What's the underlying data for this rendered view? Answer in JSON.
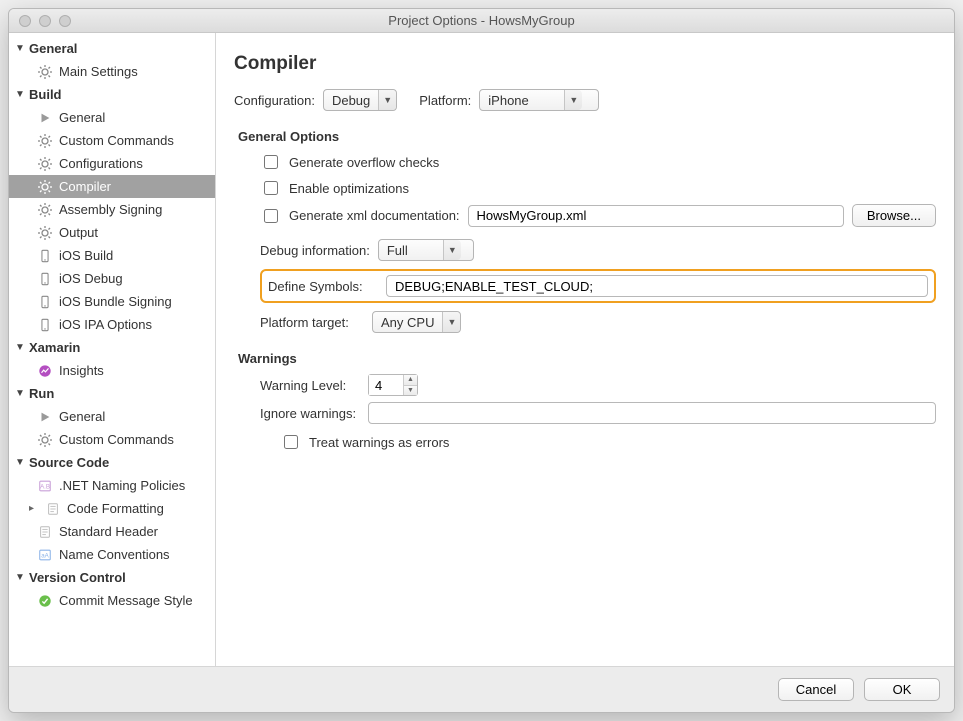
{
  "window": {
    "title": "Project Options - HowsMyGroup"
  },
  "sidebar": {
    "general": {
      "label": "General",
      "items": [
        {
          "label": "Main Settings"
        }
      ]
    },
    "build": {
      "label": "Build",
      "items": [
        {
          "label": "General"
        },
        {
          "label": "Custom Commands"
        },
        {
          "label": "Configurations"
        },
        {
          "label": "Compiler"
        },
        {
          "label": "Assembly Signing"
        },
        {
          "label": "Output"
        },
        {
          "label": "iOS Build"
        },
        {
          "label": "iOS Debug"
        },
        {
          "label": "iOS Bundle Signing"
        },
        {
          "label": "iOS IPA Options"
        }
      ]
    },
    "xamarin": {
      "label": "Xamarin",
      "items": [
        {
          "label": "Insights"
        }
      ]
    },
    "run": {
      "label": "Run",
      "items": [
        {
          "label": "General"
        },
        {
          "label": "Custom Commands"
        }
      ]
    },
    "source_code": {
      "label": "Source Code",
      "items": [
        {
          "label": ".NET Naming Policies"
        },
        {
          "label": "Code Formatting"
        },
        {
          "label": "Standard Header"
        },
        {
          "label": "Name Conventions"
        }
      ]
    },
    "version_control": {
      "label": "Version Control",
      "items": [
        {
          "label": "Commit Message Style"
        }
      ]
    }
  },
  "page": {
    "heading": "Compiler",
    "config": {
      "label": "Configuration:",
      "value": "Debug"
    },
    "platform": {
      "label": "Platform:",
      "value": "iPhone"
    },
    "general_options": {
      "title": "General Options",
      "overflow": {
        "label": "Generate overflow checks",
        "checked": false
      },
      "optimize": {
        "label": "Enable optimizations",
        "checked": false
      },
      "xmldoc": {
        "label": "Generate xml documentation:",
        "checked": false,
        "value": "HowsMyGroup.xml",
        "browse": "Browse..."
      },
      "debug_info": {
        "label": "Debug information:",
        "value": "Full"
      },
      "define_symbols": {
        "label": "Define Symbols:",
        "value": "DEBUG;ENABLE_TEST_CLOUD;"
      },
      "platform_target": {
        "label": "Platform target:",
        "value": "Any CPU"
      }
    },
    "warnings": {
      "title": "Warnings",
      "level": {
        "label": "Warning Level:",
        "value": "4"
      },
      "ignore": {
        "label": "Ignore warnings:",
        "value": ""
      },
      "as_errors": {
        "label": "Treat warnings as errors",
        "checked": false
      }
    }
  },
  "footer": {
    "cancel": "Cancel",
    "ok": "OK"
  }
}
